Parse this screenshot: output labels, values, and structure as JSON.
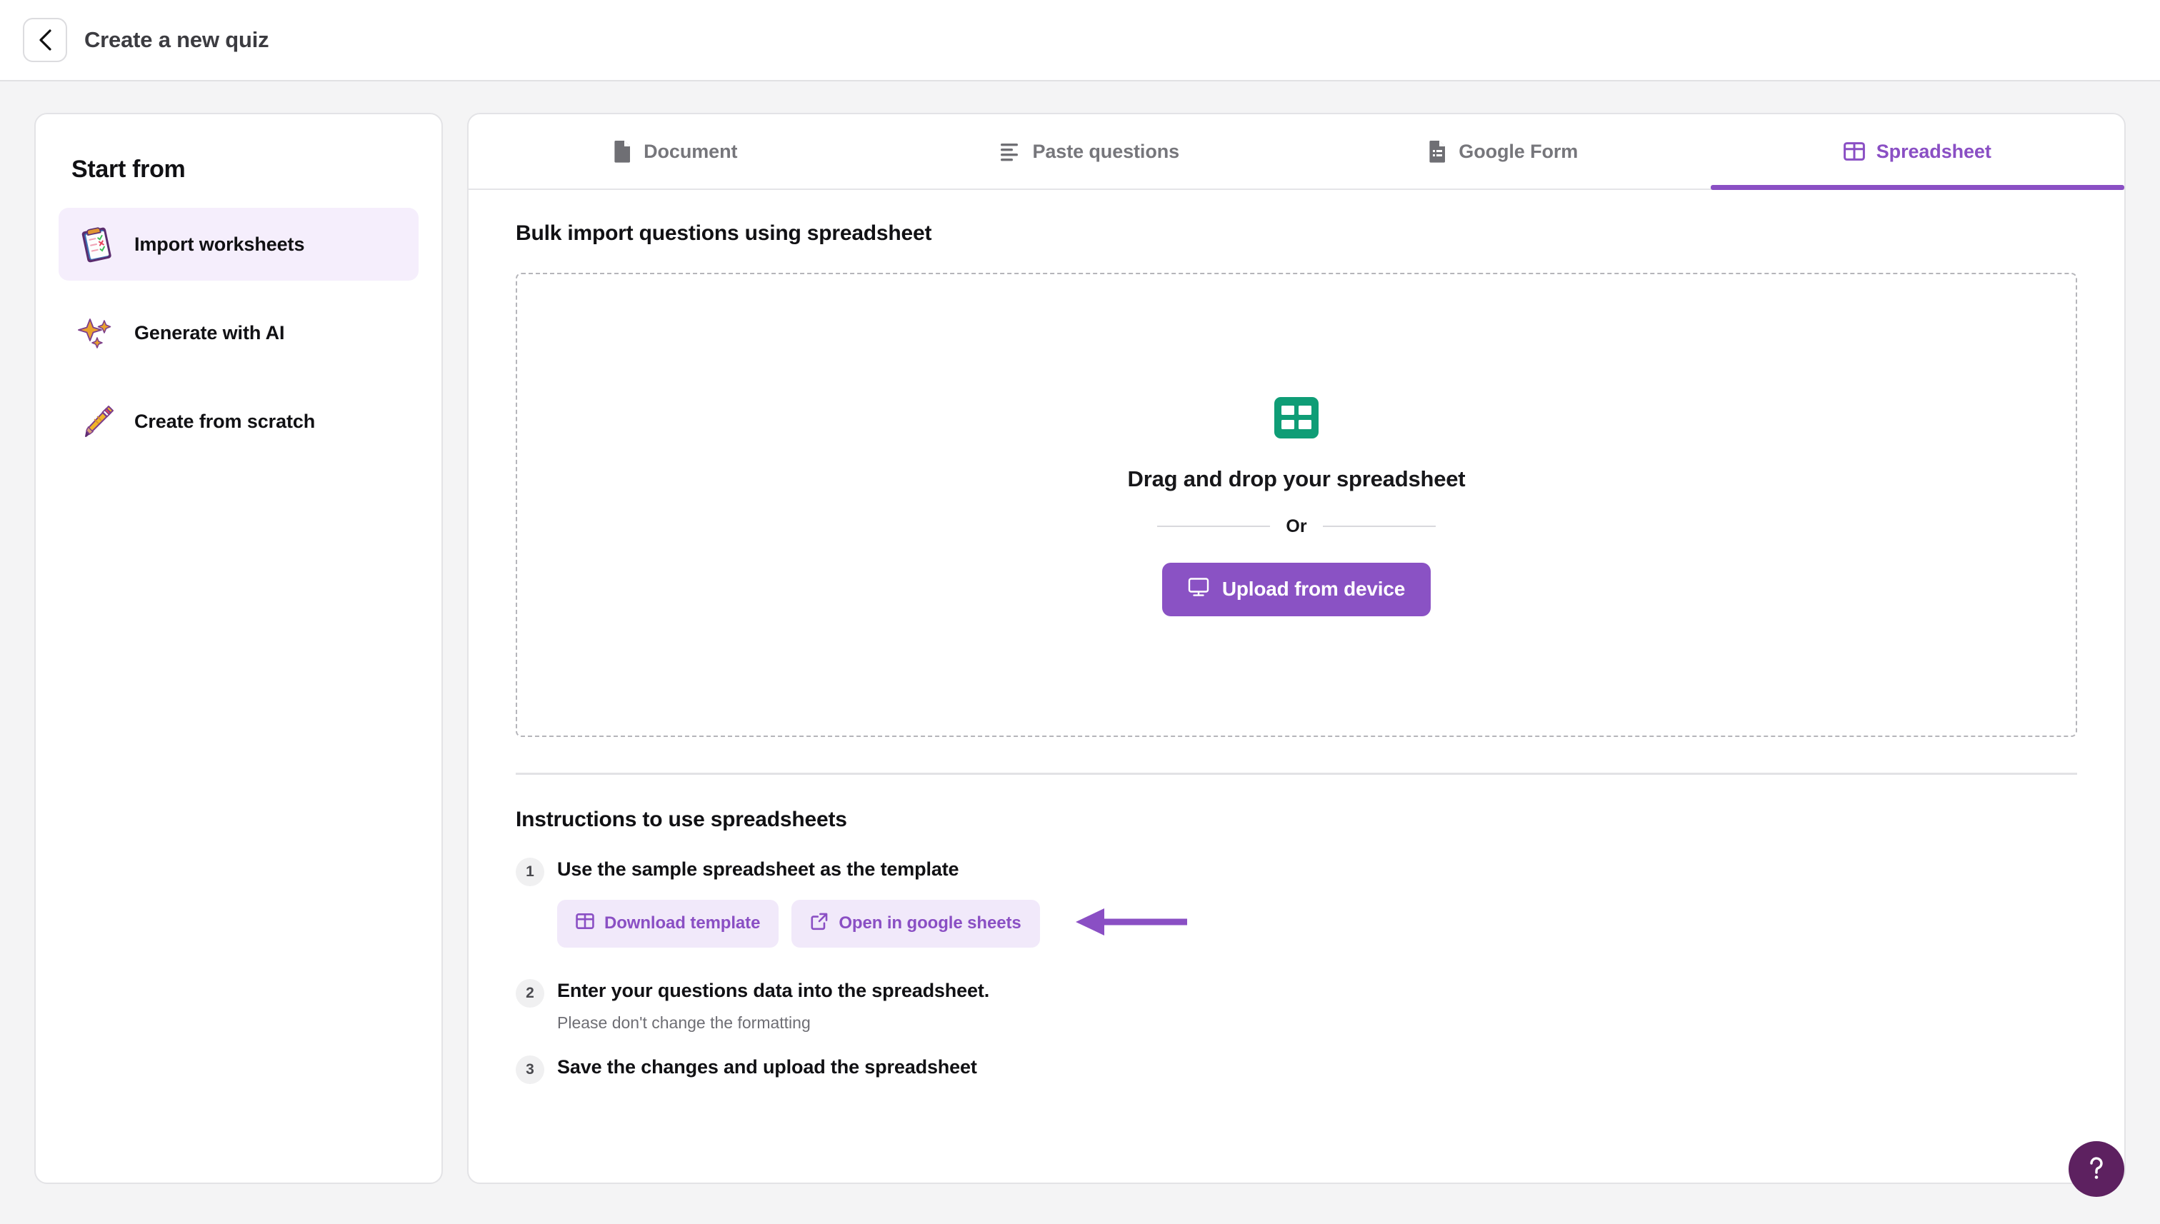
{
  "header": {
    "back_icon": "chevron-left-icon",
    "title": "Create a new quiz"
  },
  "sidebar": {
    "title": "Start from",
    "items": [
      {
        "label": "Import worksheets",
        "icon": "clipboard-emoji",
        "active": true
      },
      {
        "label": "Generate with AI",
        "icon": "sparkles-emoji",
        "active": false
      },
      {
        "label": "Create from scratch",
        "icon": "pencil-emoji",
        "active": false
      }
    ]
  },
  "tabs": [
    {
      "label": "Document",
      "icon": "file-icon",
      "active": false
    },
    {
      "label": "Paste questions",
      "icon": "align-left-icon",
      "active": false
    },
    {
      "label": "Google Form",
      "icon": "form-icon",
      "active": false
    },
    {
      "label": "Spreadsheet",
      "icon": "table-grid-icon",
      "active": true
    }
  ],
  "panel": {
    "title": "Bulk import questions using spreadsheet",
    "dropzone": {
      "icon": "green-spreadsheet-icon",
      "text": "Drag and drop your spreadsheet",
      "or_label": "Or",
      "upload_button": "Upload from device",
      "upload_icon": "monitor-icon"
    },
    "instructions": {
      "title": "Instructions to use spreadsheets",
      "steps": [
        {
          "num": "1",
          "text": "Use the sample spreadsheet as the template",
          "sub": ""
        },
        {
          "num": "2",
          "text": "Enter your questions data into the spreadsheet.",
          "sub": "Please don't change the formatting"
        },
        {
          "num": "3",
          "text": "Save the changes and upload the spreadsheet",
          "sub": ""
        }
      ],
      "chips": [
        {
          "label": "Download template",
          "icon": "table-grid-icon"
        },
        {
          "label": "Open in google sheets",
          "icon": "external-link-icon"
        }
      ],
      "annotation": "left-arrow-annotation"
    }
  },
  "help": {
    "icon": "question-mark-icon",
    "label": "?"
  },
  "colors": {
    "accent_purple": "#8a4fc4",
    "upload_purple": "#8a52c4",
    "chip_bg": "#f1e9fa",
    "sheet_green": "#0f9d76",
    "help_purple": "#5d2160",
    "page_bg": "#f4f4f5"
  }
}
